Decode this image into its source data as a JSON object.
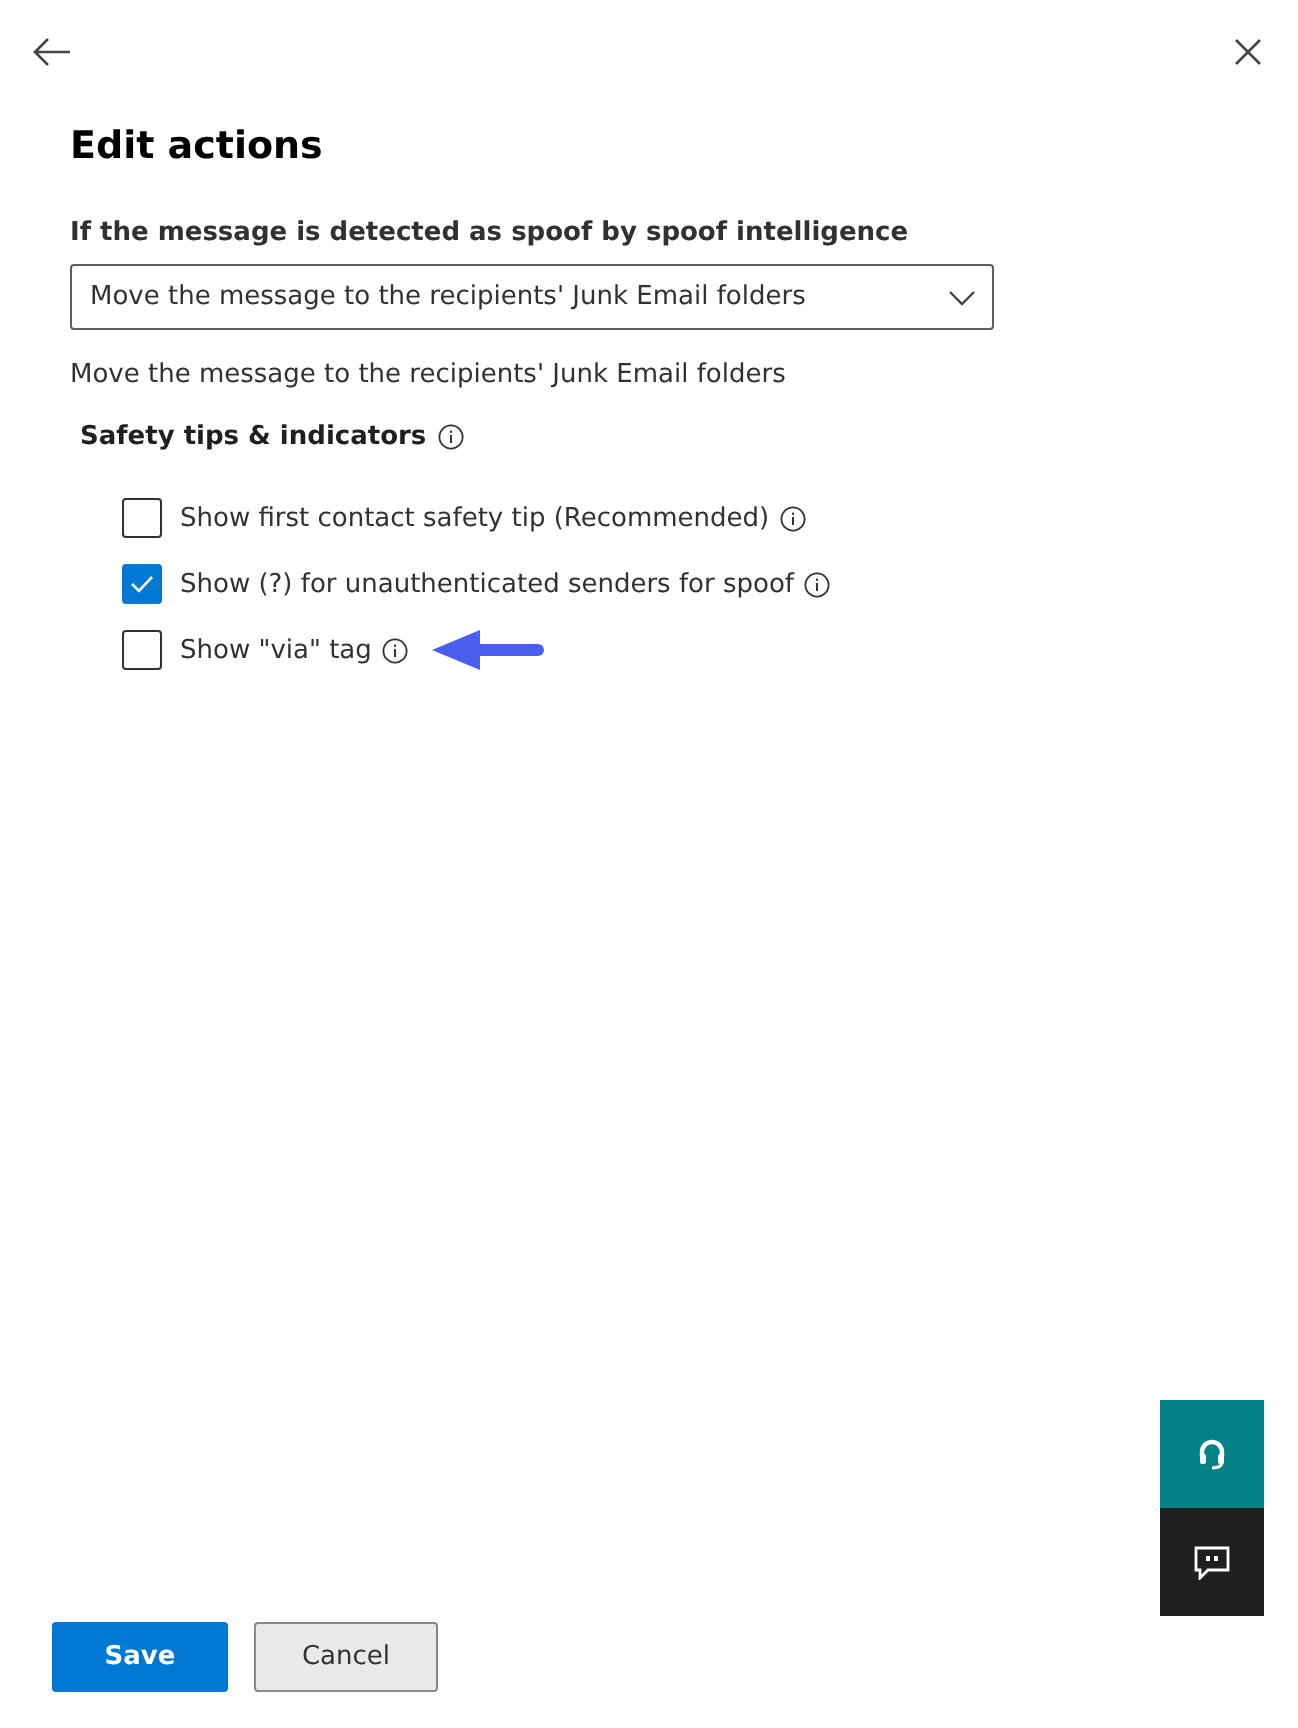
{
  "title": "Edit actions",
  "spoof_action": {
    "label": "If the message is detected as spoof by spoof intelligence",
    "value": "Move the message to the recipients' Junk Email folders",
    "description": "Move the message to the recipients' Junk Email folders"
  },
  "safety": {
    "heading": "Safety tips & indicators",
    "options": [
      {
        "label": "Show first contact safety tip (Recommended)",
        "checked": false,
        "pointer": false
      },
      {
        "label": "Show (?) for unauthenticated senders for spoof",
        "checked": true,
        "pointer": false
      },
      {
        "label": "Show \"via\" tag",
        "checked": false,
        "pointer": true
      }
    ]
  },
  "buttons": [
    {
      "label": "Save",
      "kind": "primary"
    },
    {
      "label": "Cancel",
      "kind": "secondary"
    }
  ]
}
